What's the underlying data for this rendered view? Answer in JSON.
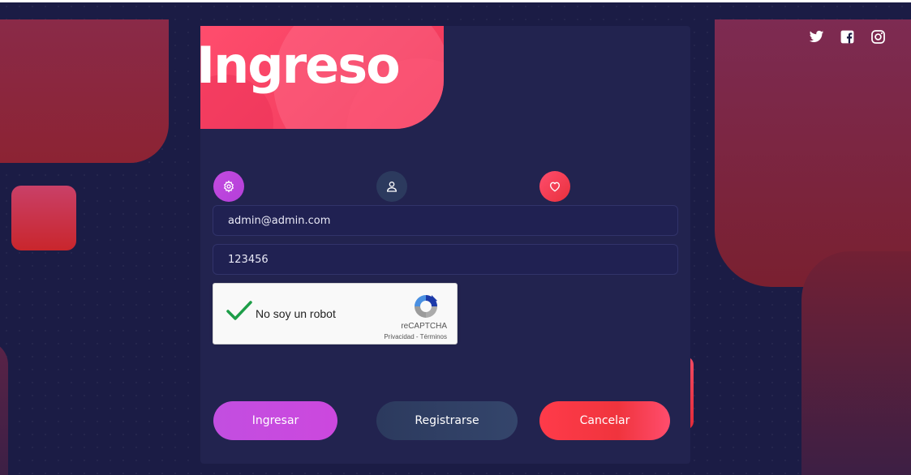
{
  "header": {
    "title": "Ingreso"
  },
  "social": [
    "twitter-icon",
    "facebook-icon",
    "instagram-icon"
  ],
  "tabs": [
    {
      "icon": "gear-icon",
      "color": "#c34be0"
    },
    {
      "icon": "user-icon",
      "color": "#2c3a5e"
    },
    {
      "icon": "heart-icon",
      "color": "#f0343d"
    }
  ],
  "form": {
    "email_value": "admin@admin.com",
    "password_value": "123456"
  },
  "captcha": {
    "label": "No soy un robot",
    "brand": "reCAPTCHA",
    "privacy_link": "Privacidad",
    "separator": " - ",
    "terms_link": "Términos",
    "checked": true
  },
  "buttons": {
    "login": "Ingresar",
    "register": "Registrarse",
    "cancel": "Cancelar"
  },
  "colors": {
    "background": "#1b1c45",
    "panel": "#22234f",
    "accent_pink": "#ff4d6d",
    "accent_purple": "#c24ee0",
    "accent_red": "#f0343d"
  }
}
